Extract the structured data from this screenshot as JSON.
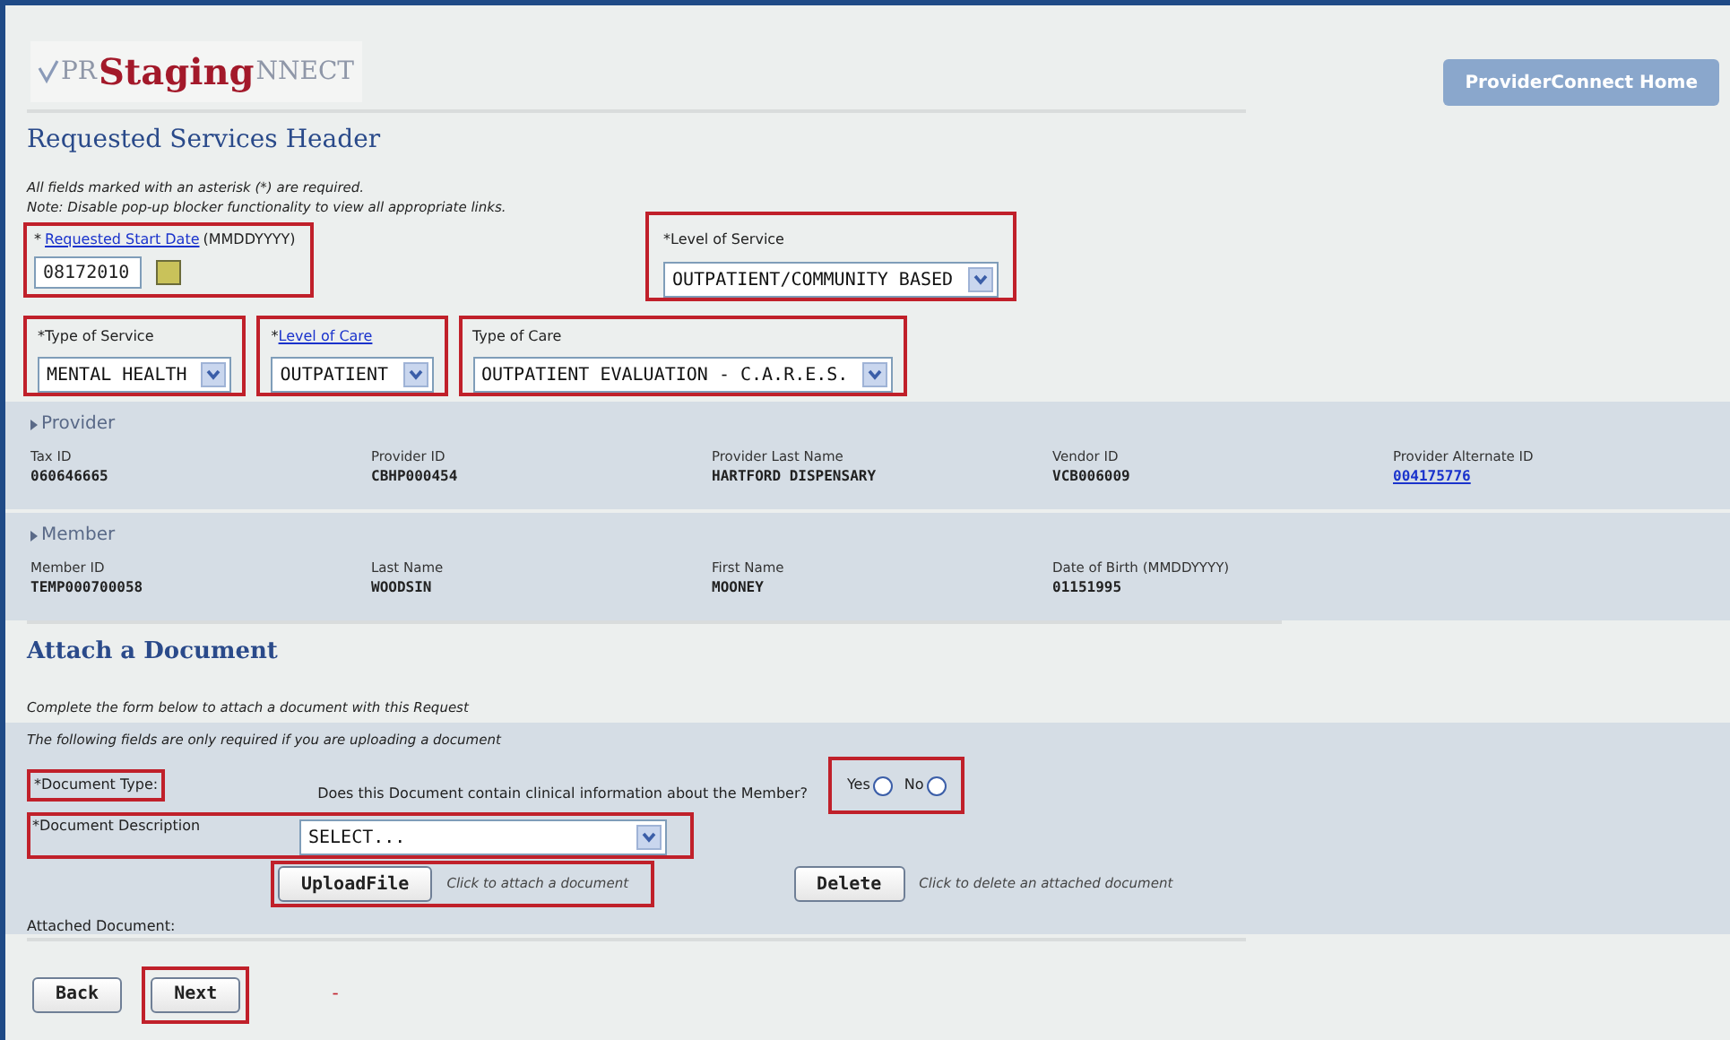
{
  "logo": {
    "left": "PR",
    "right": "NNECT",
    "overlay": "Staging"
  },
  "home_button": "ProviderConnect Home",
  "header": {
    "title": "Requested Services Header",
    "notes": [
      "All fields marked with an asterisk (*) are required.",
      "Note: Disable pop-up blocker functionality to view all appropriate links."
    ]
  },
  "start_date": {
    "prefix": "*",
    "link": "Requested Start Date",
    "hint": "(MMDDYYYY)",
    "value": "08172010",
    "highlighted": true
  },
  "level_of_service": {
    "prefix": "*",
    "label": "Level of Service",
    "value": "OUTPATIENT/COMMUNITY BASED",
    "highlighted": true
  },
  "selects": [
    {
      "prefix": "*",
      "label": "Type of Service",
      "link": false,
      "value": "MENTAL HEALTH",
      "highlighted": true
    },
    {
      "prefix": "*",
      "label": "Level of Care",
      "link": true,
      "value": "OUTPATIENT",
      "highlighted": true
    },
    {
      "label": "Type of Care",
      "link": false,
      "value": "OUTPATIENT EVALUATION - C.A.R.E.S.",
      "highlighted": true
    }
  ],
  "sections": [
    {
      "title": "Provider",
      "fields": [
        {
          "label": "Tax ID",
          "value": "060646665",
          "link": false
        },
        {
          "label": "Provider ID",
          "value": "CBHP000454",
          "link": false
        },
        {
          "label": "Provider Last Name",
          "value": "HARTFORD DISPENSARY",
          "link": false
        },
        {
          "label": "Vendor ID",
          "value": "VCB006009",
          "link": false
        },
        {
          "label": "Provider Alternate ID",
          "value": "004175776",
          "link": true
        }
      ]
    },
    {
      "title": "Member",
      "fields": [
        {
          "label": "Member ID",
          "value": "TEMP000700058",
          "link": false
        },
        {
          "label": "Last Name",
          "value": "WOODSIN",
          "link": false
        },
        {
          "label": "First Name",
          "value": "MOONEY",
          "link": false
        },
        {
          "label": "Date of Birth (MMDDYYYY)",
          "value": "01151995",
          "link": false
        }
      ]
    }
  ],
  "attach": {
    "title": "Attach a Document",
    "intro": "Complete the form below to attach a document with this Request",
    "note": "The following fields are only required if you are uploading a document",
    "document_type": {
      "label": "*Document Type:",
      "highlighted": true
    },
    "question": "Does this Document contain clinical information about the Member?",
    "radios": {
      "highlighted": true,
      "options": [
        {
          "label": "Yes",
          "selected": false
        },
        {
          "label": "No",
          "selected": false
        }
      ]
    },
    "description": {
      "label": "*Document Description",
      "value": "SELECT...",
      "highlighted": true
    },
    "upload": {
      "button": "UploadFile",
      "hint": "Click to attach a document",
      "highlighted": true
    },
    "delete": {
      "button": "Delete",
      "hint": "Click to delete an attached document"
    },
    "attached_label": "Attached Document:"
  },
  "footer": {
    "buttons": [
      {
        "label": "Back",
        "highlighted": false
      },
      {
        "label": "Next",
        "highlighted": true
      }
    ],
    "dash": "-"
  }
}
